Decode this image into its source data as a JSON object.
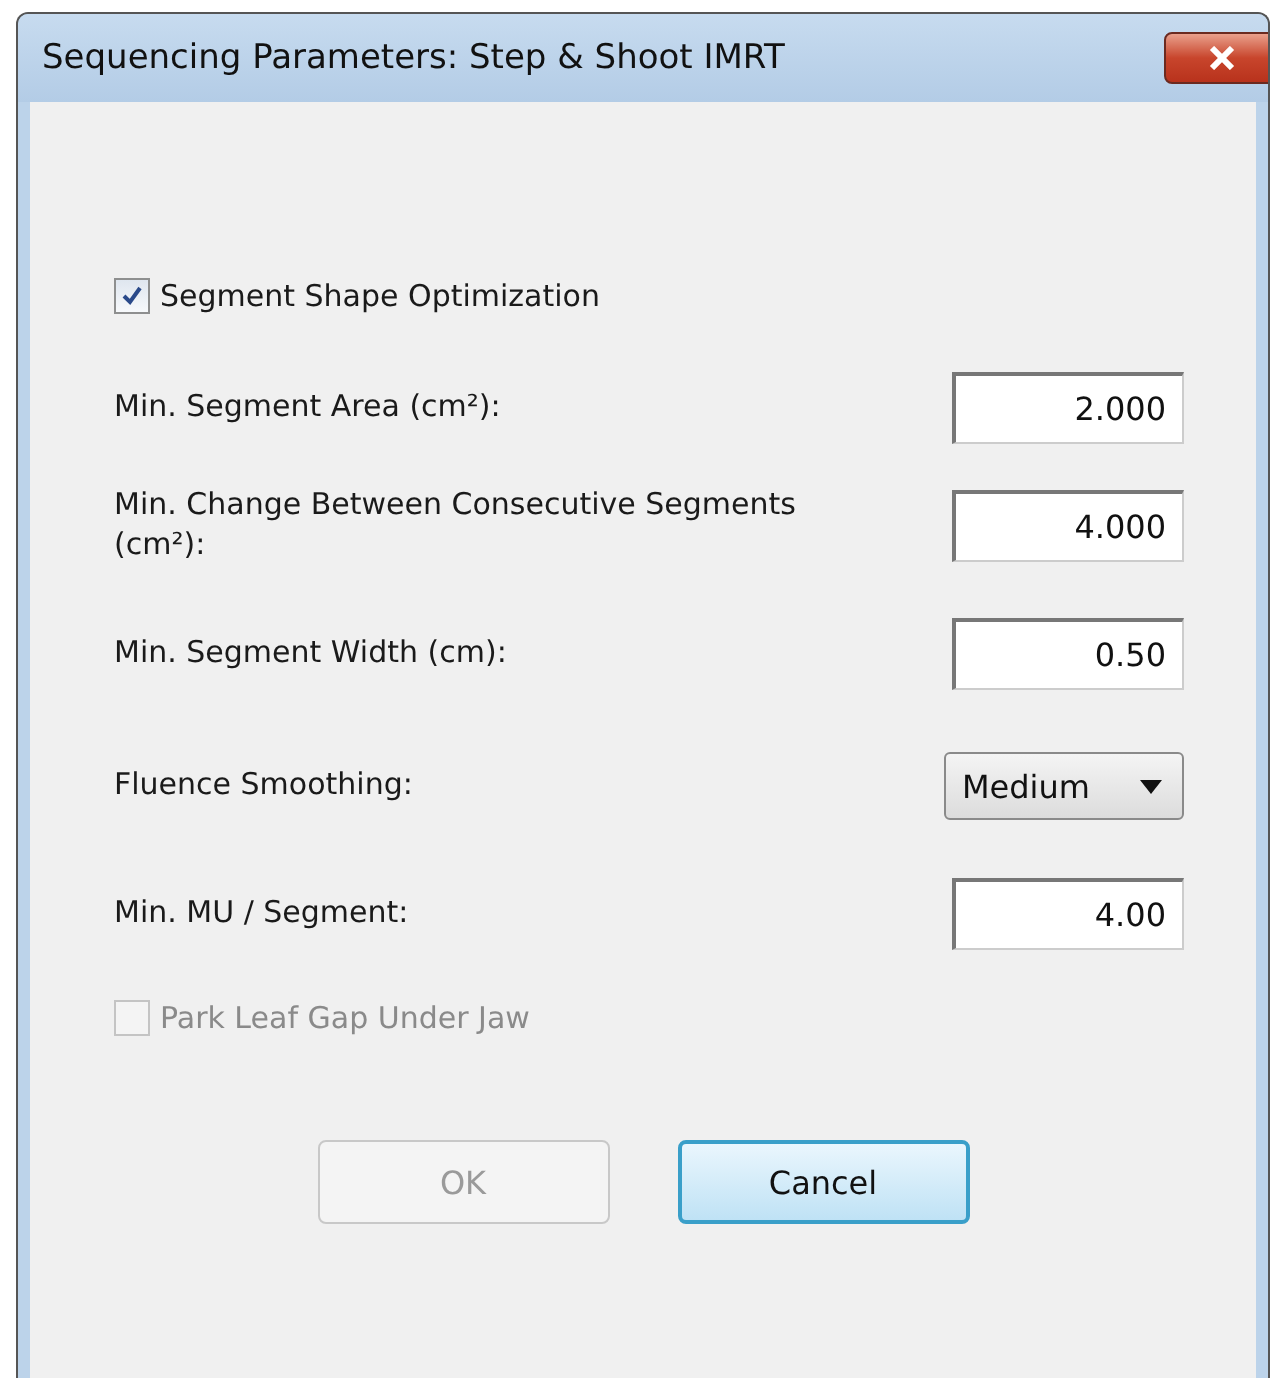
{
  "window": {
    "title": "Sequencing Parameters: Step & Shoot IMRT"
  },
  "optimization": {
    "label": "Segment Shape Optimization",
    "checked": true,
    "disabled": false
  },
  "fields": [
    {
      "kind": "input",
      "label": "Min. Segment Area (cm²):",
      "value": "2.000"
    },
    {
      "kind": "input",
      "label": "Min. Change Between Consecutive Segments (cm²):",
      "value": "4.000"
    },
    {
      "kind": "input",
      "label": "Min. Segment Width (cm):",
      "value": "0.50"
    },
    {
      "kind": "dropdown",
      "label": "Fluence Smoothing:",
      "value": "Medium"
    },
    {
      "kind": "input",
      "label": "Min. MU / Segment:",
      "value": "4.00"
    }
  ],
  "park_leaf_gap": {
    "label": "Park Leaf Gap Under Jaw",
    "checked": false,
    "disabled": true
  },
  "buttons": [
    {
      "label": "OK",
      "disabled": true,
      "focused": false
    },
    {
      "label": "Cancel",
      "disabled": false,
      "focused": true
    }
  ]
}
